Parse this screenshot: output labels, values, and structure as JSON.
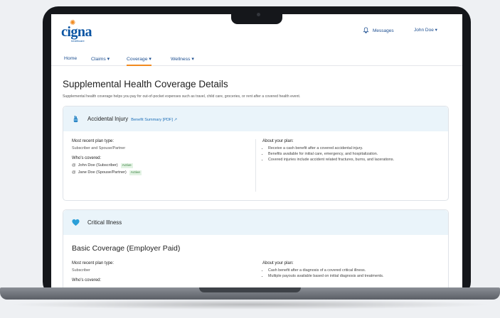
{
  "header": {
    "logo_text": "cigna",
    "logo_subtext": "healthcare",
    "messages_label": "Messages",
    "user_label": "John Doe ▾"
  },
  "nav": {
    "items": [
      {
        "label": "Home"
      },
      {
        "label": "Claims ▾"
      },
      {
        "label": "Coverage ▾"
      },
      {
        "label": "Wellness ▾"
      }
    ]
  },
  "page": {
    "title": "Supplemental Health Coverage Details",
    "intro": "Supplemental health coverage helps you pay for out-of-pocket expenses such as travel, child care, groceries, or rent after a covered health event."
  },
  "accidental": {
    "title": "Accidental Injury",
    "link": "Benefit Summary [PDF] ↗",
    "plan_type_label": "Most recent plan type:",
    "plan_type_value": "Subscriber and Spouse/Partner",
    "whos_covered_label": "Who's covered:",
    "members": [
      {
        "name": "John Doe (Subscriber)",
        "status": "Active"
      },
      {
        "name": "Jane Doe (Spouse/Partner)",
        "status": "Active"
      }
    ],
    "about_label": "About your plan:",
    "bullets": [
      "Receive a cash benefit after a covered accidental injury.",
      "Benefits available for initial care, emergency, and hospitalization.",
      "Covered injuries include accident related fractures, burns, and lacerations."
    ]
  },
  "critical": {
    "title": "Critical Illness",
    "subheading": "Basic Coverage (Employer Paid)",
    "plan_type_label": "Most recent plan type:",
    "plan_type_value": "Subscriber",
    "whos_covered_label": "Who's covered:",
    "about_label": "About your plan:",
    "bullets": [
      "Cash benefit after a diagnosis of a covered critical illness.",
      "Multiple payouts available based on initial diagnosis and treatments."
    ]
  },
  "colors": {
    "brand_blue": "#0b55a3",
    "accent_orange": "#f18a1f",
    "card_header_bg": "#eaf4fa",
    "active_badge": "#2f7a35"
  }
}
